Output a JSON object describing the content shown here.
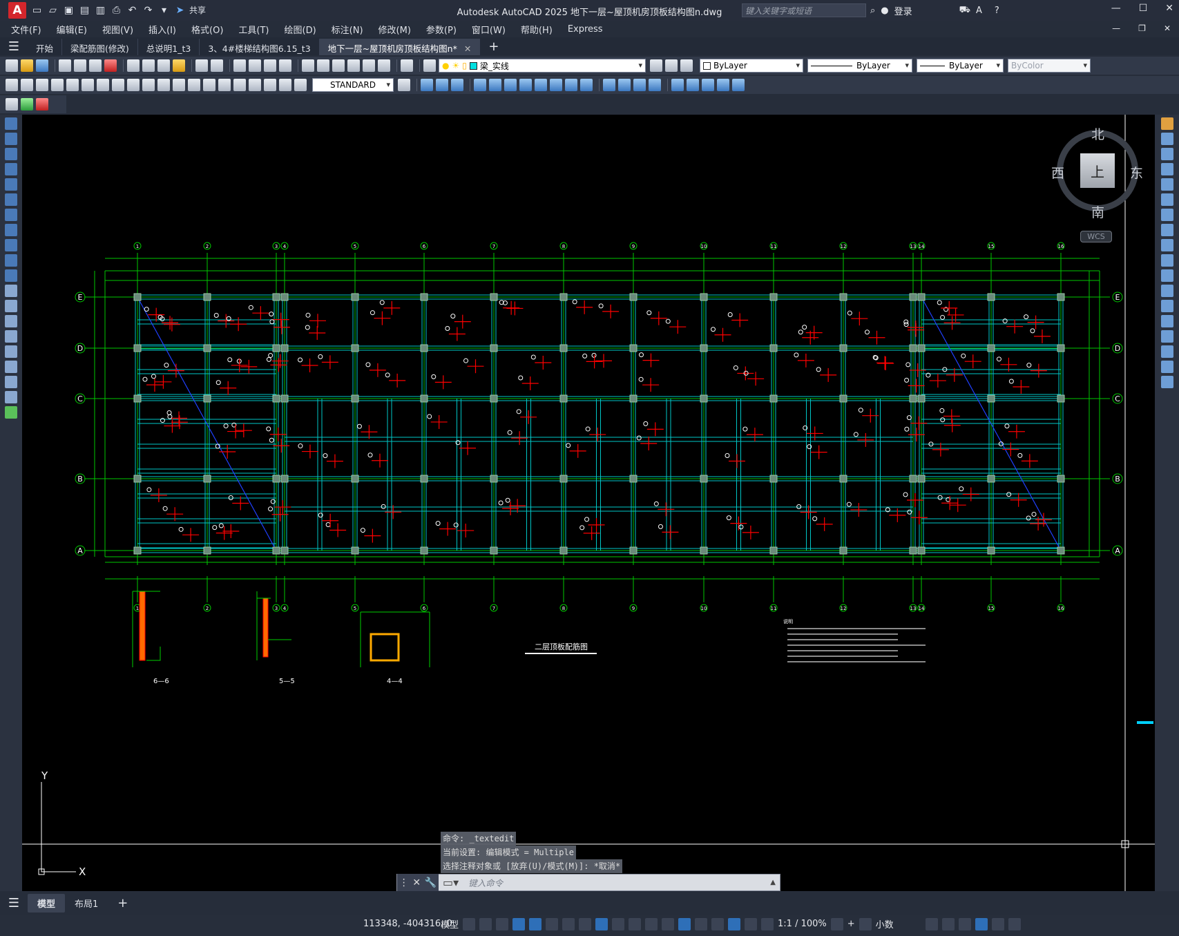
{
  "titlebar": {
    "app_logo": "A",
    "share_label": "共享",
    "title": "Autodesk AutoCAD 2025    地下一层~屋顶机房顶板结构图n.dwg",
    "search_placeholder": "键入关键字或短语",
    "login_label": "登录"
  },
  "menu": {
    "items": [
      "文件(F)",
      "编辑(E)",
      "视图(V)",
      "插入(I)",
      "格式(O)",
      "工具(T)",
      "绘图(D)",
      "标注(N)",
      "修改(M)",
      "参数(P)",
      "窗口(W)",
      "帮助(H)",
      "Express"
    ]
  },
  "tabs": {
    "items": [
      "开始",
      "梁配筋图(修改)",
      "总说明1_t3",
      "3、4#楼梯结构图6.15_t3",
      "地下一层~屋顶机房顶板结构图n*"
    ]
  },
  "toolbar": {
    "layer_name": "梁_实线",
    "color": "ByLayer",
    "linetype": "ByLayer",
    "lineweight": "ByLayer",
    "plotstyle": "ByColor",
    "textstyle": "STANDARD"
  },
  "viewcube": {
    "north": "北",
    "south": "南",
    "east": "东",
    "west": "西",
    "face": "上",
    "wcs": "WCS"
  },
  "drawing": {
    "plan_title": "二层顶板配筋图",
    "axes_top": [
      "1",
      "2",
      "3",
      "4",
      "5",
      "6",
      "7",
      "8",
      "9",
      "10",
      "11",
      "12",
      "13",
      "14",
      "15",
      "16"
    ],
    "axes_side": [
      "E",
      "D",
      "C",
      "B",
      "A"
    ],
    "sections": [
      "6—6",
      "5—5",
      "4—4"
    ],
    "notes_title": "说明",
    "ucs_x": "X",
    "ucs_y": "Y"
  },
  "command": {
    "history": [
      "命令: _textedit",
      "当前设置: 编辑模式 = Multiple",
      "选择注释对象或 [放弃(U)/模式(M)]: *取消*"
    ],
    "placeholder": "键入命令"
  },
  "layouts": {
    "items": [
      "模型",
      "布局1"
    ]
  },
  "status": {
    "coords": "113348, -404316, 0",
    "model": "模型",
    "scale": "1:1 / 100%",
    "units": "小数"
  },
  "colors": {
    "grid": "#00c800",
    "beam": "#00c8c8",
    "rebar": "#ff0000",
    "bg": "#000000"
  }
}
